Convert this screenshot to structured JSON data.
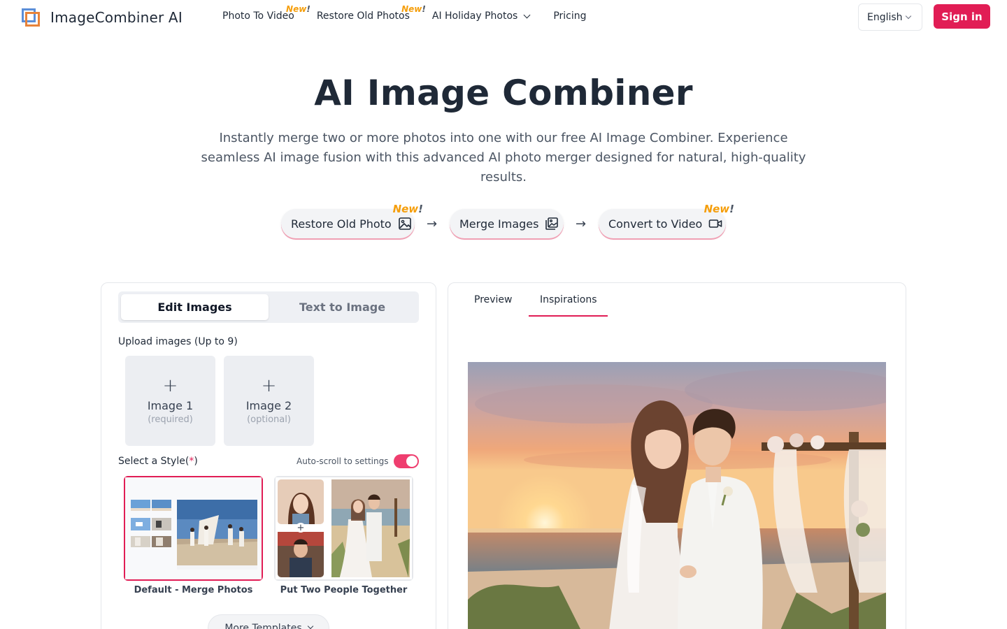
{
  "header": {
    "logo_text": "ImageCombiner AI",
    "nav": [
      {
        "label": "Photo To Video",
        "badge": "New",
        "badge_mark": "!"
      },
      {
        "label": "Restore Old Photos",
        "badge": "New",
        "badge_mark": "!"
      },
      {
        "label": "AI Holiday Photos",
        "has_dropdown": true
      },
      {
        "label": "Pricing"
      }
    ],
    "language": "English",
    "signin_label": "Sign in"
  },
  "hero": {
    "title": "AI Image Combiner",
    "subtitle": "Instantly merge two or more photos into one with our free AI Image Combiner. Experience seamless AI image fusion with this advanced AI photo merger designed for natural, high-quality results."
  },
  "flow": {
    "steps": [
      {
        "label": "Restore Old Photo",
        "icon": "image-icon",
        "badge": "New",
        "badge_mark": "!"
      },
      {
        "label": "Merge Images",
        "icon": "images-stack-icon"
      },
      {
        "label": "Convert to Video",
        "icon": "video-camera-icon",
        "badge": "New",
        "badge_mark": "!"
      }
    ],
    "arrow": "→"
  },
  "editor": {
    "tabs": [
      "Edit Images",
      "Text to Image"
    ],
    "active_tab": "Edit Images",
    "upload_label": "Upload images (Up to 9)",
    "uploads": [
      {
        "plus": "+",
        "name": "Image 1",
        "note": "(required)"
      },
      {
        "plus": "+",
        "name": "Image 2",
        "note": "(optional)"
      }
    ],
    "style_label": "Select a Style",
    "style_required_open": "(",
    "style_required_mark": "*",
    "style_required_close": ")",
    "auto_scroll_label": "Auto-scroll to settings",
    "auto_scroll_on": true,
    "templates": [
      {
        "caption": "Default - Merge Photos",
        "selected": true
      },
      {
        "caption": "Put Two People Together",
        "selected": false,
        "plus": "+"
      }
    ],
    "more_templates_label": "More Templates"
  },
  "preview": {
    "tabs": [
      "Preview",
      "Inspirations"
    ],
    "active_tab": "Inspirations"
  },
  "colors": {
    "accent": "#e11d55",
    "badge": "#f59e0b",
    "logo_blue": "#5b8ed8",
    "logo_orange": "#e8833a"
  }
}
